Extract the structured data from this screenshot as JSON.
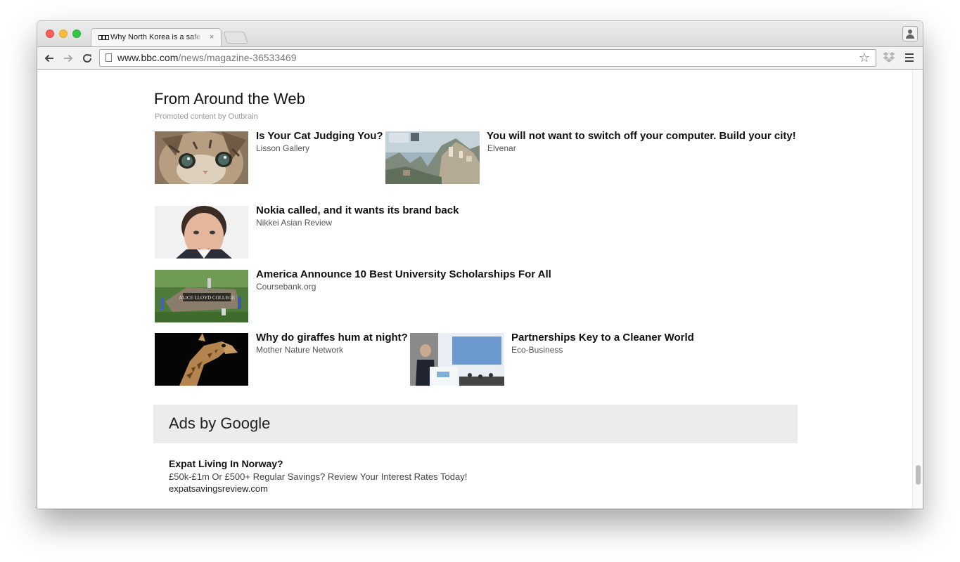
{
  "browser": {
    "tab_title": "Why North Korea is a safe",
    "tab_close": "×",
    "url_domain": "www.bbc.com",
    "url_path": "/news/magazine-36533469",
    "icons": {
      "back": "arrow-left",
      "forward": "arrow-right",
      "reload": "reload",
      "star": "star-outline",
      "menu": "hamburger"
    }
  },
  "outbrain": {
    "title": "From Around the Web",
    "subtitle": "Promoted content by Outbrain",
    "items": [
      {
        "title": "Is Your Cat Judging You?",
        "source": "Lisson Gallery",
        "image": "kitten"
      },
      {
        "title": "You will not want to switch off your computer. Build your city!",
        "source": "Elvenar",
        "image": "fantasy-city"
      },
      {
        "title": "Nokia called, and it wants its brand back",
        "source": "Nikkei Asian Review",
        "image": "man-portrait"
      },
      {
        "title": "America Announce 10 Best University Scholarships For All",
        "source": "Coursebank.org",
        "image": "college-sign"
      },
      {
        "title": "Why do giraffes hum at night?",
        "source": "Mother Nature Network",
        "image": "giraffe"
      },
      {
        "title": "Partnerships Key to a Cleaner World",
        "source": "Eco-Business",
        "image": "conference-speaker"
      }
    ]
  },
  "ads": {
    "header": "Ads by Google",
    "items": [
      {
        "headline": "Expat Living In Norway?",
        "description": "£50k-£1m Or £500+ Regular Savings? Review Your Interest Rates Today!",
        "url": "expatsavingsreview.com"
      }
    ]
  },
  "colors": {
    "ads_background": "#ececec",
    "text_primary": "#111111",
    "text_source": "#555555",
    "promo_text": "#999999"
  }
}
